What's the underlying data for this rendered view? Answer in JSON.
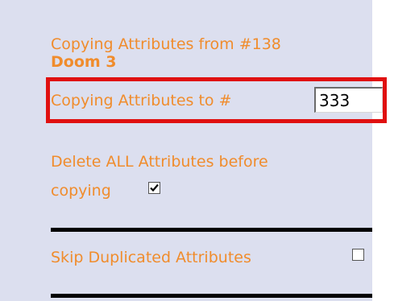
{
  "copy_from": {
    "label": "Copying Attributes from #138",
    "source_name": "Doom 3"
  },
  "copy_to": {
    "label": "Copying Attributes to #",
    "target_id": "333"
  },
  "delete_all": {
    "label_line1": "Delete ALL Attributes before",
    "label_line2": "copying",
    "checked": true
  },
  "skip_duplicates": {
    "label": "Skip Duplicated Attributes",
    "checked": false
  },
  "colors": {
    "label_orange": "#f08c2c",
    "panel_bg": "#dcdfef",
    "highlight_red": "#e01010"
  },
  "icons": {
    "checked_box": "checkbox-checked-icon",
    "unchecked_box": "checkbox-unchecked-icon"
  }
}
